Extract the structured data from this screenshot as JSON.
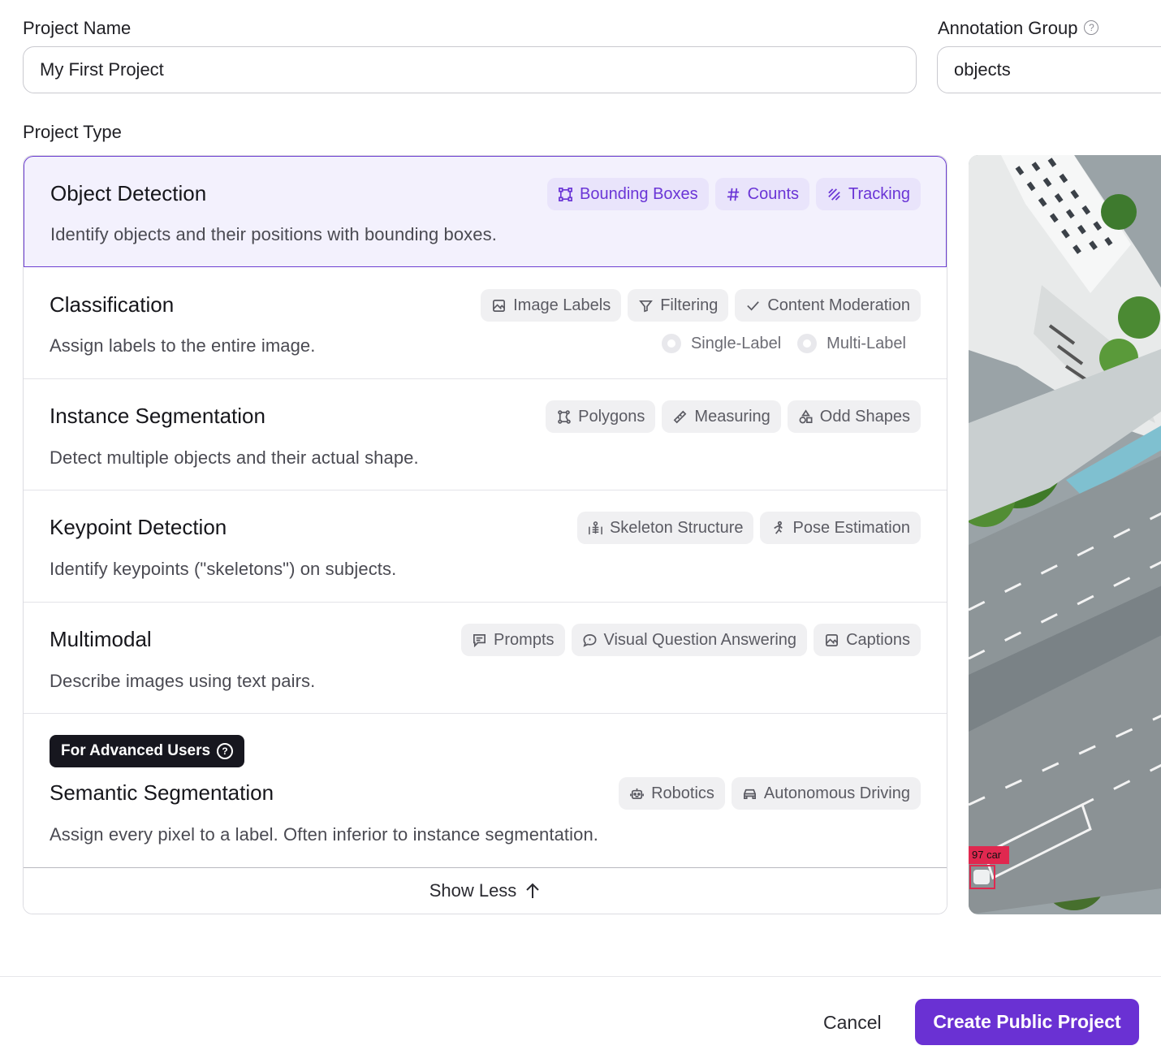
{
  "project_name": {
    "label": "Project Name",
    "value": "My First Project"
  },
  "annotation_group": {
    "label": "Annotation Group",
    "value": "objects",
    "help_icon": "question-circle-icon"
  },
  "project_type_label": "Project Type",
  "types": [
    {
      "title": "Object Detection",
      "description": "Identify objects and their positions with bounding boxes.",
      "selected": true,
      "chips": [
        {
          "label": "Bounding Boxes",
          "icon": "bounding-box-icon"
        },
        {
          "label": "Counts",
          "icon": "hash-icon"
        },
        {
          "label": "Tracking",
          "icon": "tracking-icon"
        }
      ]
    },
    {
      "title": "Classification",
      "description": "Assign labels to the entire image.",
      "selected": false,
      "chips": [
        {
          "label": "Image Labels",
          "icon": "image-icon"
        },
        {
          "label": "Filtering",
          "icon": "filter-icon"
        },
        {
          "label": "Content Moderation",
          "icon": "check-icon"
        }
      ],
      "options": [
        "Single-Label",
        "Multi-Label"
      ]
    },
    {
      "title": "Instance Segmentation",
      "description": "Detect multiple objects and their actual shape.",
      "selected": false,
      "chips": [
        {
          "label": "Polygons",
          "icon": "polygon-icon"
        },
        {
          "label": "Measuring",
          "icon": "ruler-icon"
        },
        {
          "label": "Odd Shapes",
          "icon": "shapes-icon"
        }
      ]
    },
    {
      "title": "Keypoint Detection",
      "description": "Identify keypoints (\"skeletons\") on subjects.",
      "selected": false,
      "chips": [
        {
          "label": "Skeleton Structure",
          "icon": "skeleton-icon"
        },
        {
          "label": "Pose Estimation",
          "icon": "running-person-icon"
        }
      ]
    },
    {
      "title": "Multimodal",
      "description": "Describe images using text pairs.",
      "selected": false,
      "chips": [
        {
          "label": "Prompts",
          "icon": "message-icon"
        },
        {
          "label": "Visual Question Answering",
          "icon": "speech-bubble-icon"
        },
        {
          "label": "Captions",
          "icon": "image-icon"
        }
      ]
    },
    {
      "title": "Semantic Segmentation",
      "description": "Assign every pixel to a label. Often inferior to instance segmentation.",
      "selected": false,
      "badge": "For Advanced Users",
      "chips": [
        {
          "label": "Robotics",
          "icon": "robot-icon"
        },
        {
          "label": "Autonomous Driving",
          "icon": "car-icon"
        }
      ]
    }
  ],
  "show_less": "Show Less",
  "preview": {
    "detection_label": "97 car",
    "accent": "#e0284f"
  },
  "footer": {
    "cancel": "Cancel",
    "create": "Create Public Project"
  },
  "colors": {
    "accent": "#6a31d3",
    "selected_bg": "#f3f1fd",
    "chip_bg": "#f0f0f2"
  }
}
